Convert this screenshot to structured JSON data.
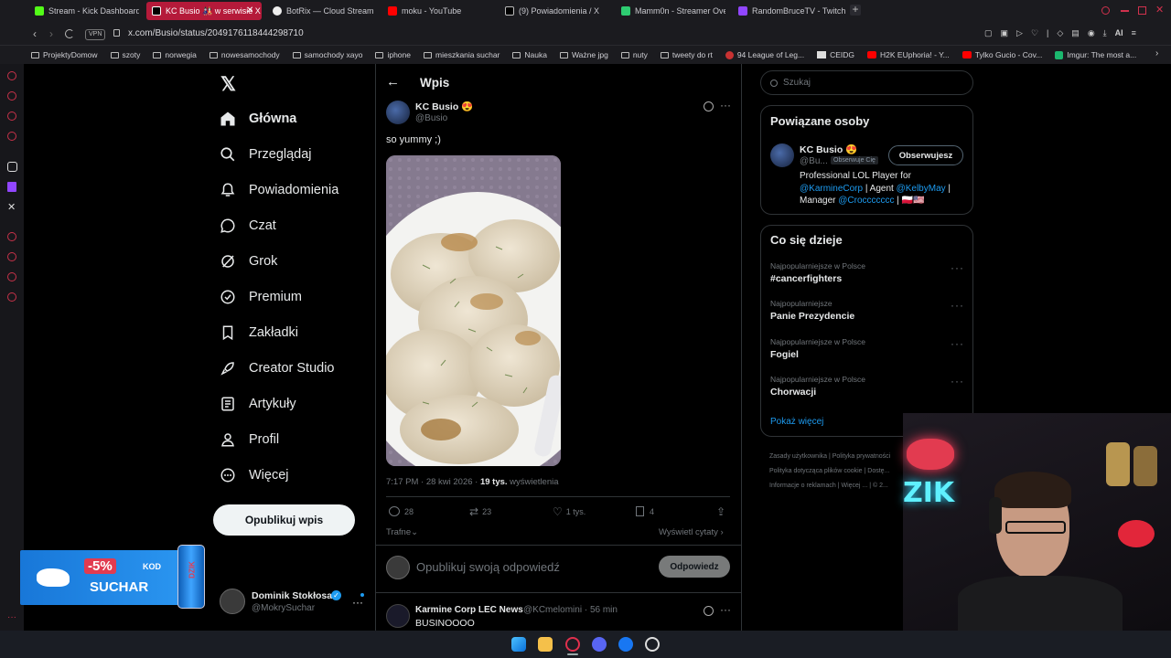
{
  "browser": {
    "tabs": [
      {
        "label": "Stream - Kick Dashboard",
        "color": "#53fc18"
      },
      {
        "label": "KC Busio 🎎 w serwisie X",
        "color": "#000000",
        "active": true
      },
      {
        "label": "BotRix — Cloud Stream",
        "color": "#ffffff"
      },
      {
        "label": "moku - YouTube",
        "color": "#ff0000"
      },
      {
        "label": "(9) Powiadomienia / X",
        "color": "#ffffff"
      },
      {
        "label": "Mamm0n - Streamer Over",
        "color": "#2ecc71"
      },
      {
        "label": "RandomBruceTV - Twitch",
        "color": "#9146ff"
      }
    ],
    "vpn": "VPN",
    "url": "x.com/Busio/status/2049176118444298710",
    "ai_label": "AI",
    "bookmarks": [
      "ProjektyDomow",
      "szoty",
      "norwegia",
      "nowesamochody",
      "samochody xayo",
      "iphone",
      "mieszkania suchar",
      "Nauka",
      "Ważne jpg",
      "nuty",
      "tweety do rt",
      "94 League of Leg...",
      "CEIDG",
      "H2K EUphoria! - Y...",
      "Tylko Gucio - Cov...",
      "Imgur: The most a..."
    ]
  },
  "sidebar": {
    "items": [
      "Główna",
      "Przeglądaj",
      "Powiadomienia",
      "Czat",
      "Grok",
      "Premium",
      "Zakładki",
      "Creator Studio",
      "Artykuły",
      "Profil",
      "Więcej"
    ],
    "post_button": "Opublikuj wpis",
    "account": {
      "name": "Dominik Stokłosa",
      "handle": "@MokrySuchar"
    }
  },
  "header": {
    "title": "Wpis"
  },
  "tweet": {
    "author": "KC Busio 😍",
    "handle": "@Busio",
    "text": "so yummy ;)",
    "time": "7:17 PM · 28 kwi 2026 · ",
    "views_num": "19 tys.",
    "views_label": " wyświetlenia",
    "replies": "28",
    "retweets": "23",
    "likes": "1 tys.",
    "bookmarks": "4",
    "sort": "Trafne",
    "quotes_link": "Wyświetl cytaty",
    "reply_placeholder": "Opublikuj swoją odpowiedź",
    "reply_button": "Odpowiedz"
  },
  "reply": {
    "author": "Karmine Corp LEC News",
    "handle": "@KCmelomini · 56 min",
    "text": "BUSINOOOO"
  },
  "search": {
    "placeholder": "Szukaj"
  },
  "related": {
    "title": "Powiązane osoby",
    "name": "KC Busio 😍",
    "handle": "@Bu...",
    "follows_you": "Obserwuje Cię",
    "follow_button": "Obserwujesz",
    "bio_1": "Professional LOL Player for ",
    "bio_link1": "@KarmineCorp",
    "bio_2": " | Agent ",
    "bio_link2": "@KelbyMay",
    "bio_3": " | Manager ",
    "bio_link3": "@Croccccccc",
    "bio_4": " | 🇵🇱🇺🇸"
  },
  "trends": {
    "title": "Co się dzieje",
    "items": [
      {
        "context": "Najpopularniejsze w Polsce",
        "name": "#cancerfighters"
      },
      {
        "context": "Najpopularniejsze",
        "name": "Panie Prezydencie"
      },
      {
        "context": "Najpopularniejsze w Polsce",
        "name": "Fogiel"
      },
      {
        "context": "Najpopularniejsze w Polsce",
        "name": "Chorwacji"
      }
    ],
    "show_more": "Pokaż więcej"
  },
  "footer": {
    "links": [
      "Zasady użytkownika",
      "Polityka prywatności",
      "Polityka dotycząca plików cookie",
      "Dostę...",
      "Informacje o reklamach",
      "Więcej ...",
      "© 2..."
    ]
  },
  "overlay": {
    "discount": "-5%",
    "kod": "KOD",
    "code": "SUCHAR",
    "brand": "DZIK"
  },
  "colors": {
    "accent": "#1d9bf0",
    "tab_active": "#b51a3a",
    "dzik_blue": "#1a7fe0"
  }
}
